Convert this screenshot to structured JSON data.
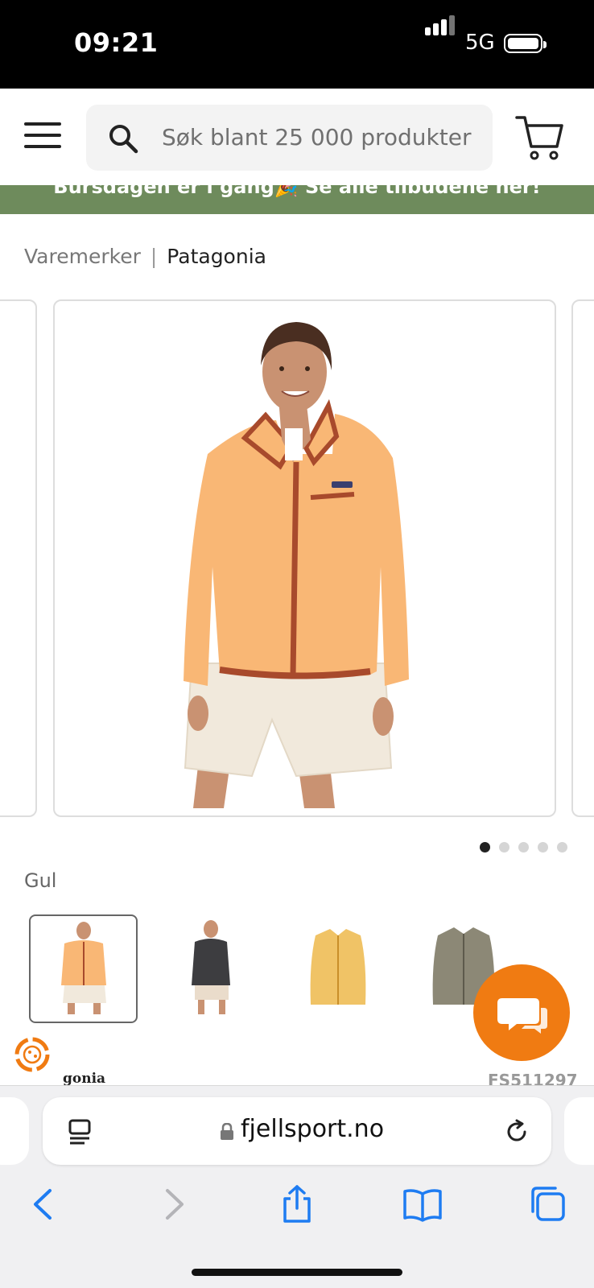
{
  "status_bar": {
    "time": "09:21",
    "network": "5G"
  },
  "header": {
    "search_placeholder": "Søk blant 25 000 produkter",
    "menu_icon": "hamburger-menu-icon",
    "search_icon": "search-icon",
    "cart_icon": "shopping-cart-icon"
  },
  "banner": {
    "text": "Bursdagen er i gang🎉 Se alle tilbudene her!"
  },
  "breadcrumb": {
    "parent": "Varemerker",
    "separator": "|",
    "current": "Patagonia"
  },
  "gallery": {
    "slide_count": 5,
    "active_slide": 1
  },
  "variant": {
    "color_label": "Gul",
    "swatches": [
      {
        "name": "gul",
        "selected": true,
        "color": "#f7b777"
      },
      {
        "name": "svart",
        "selected": false,
        "color": "#3d3d40"
      },
      {
        "name": "okergul",
        "selected": false,
        "color": "#f0c366"
      },
      {
        "name": "gronngra",
        "selected": false,
        "color": "#8c8876"
      }
    ]
  },
  "product": {
    "brand_fragment": "gonia",
    "sku": "FS511297"
  },
  "browser": {
    "host": "fjellsport.no"
  },
  "colors": {
    "banner": "#6e8b5c",
    "chat_accent": "#f07b12",
    "safari_blue": "#1e7cf2"
  }
}
